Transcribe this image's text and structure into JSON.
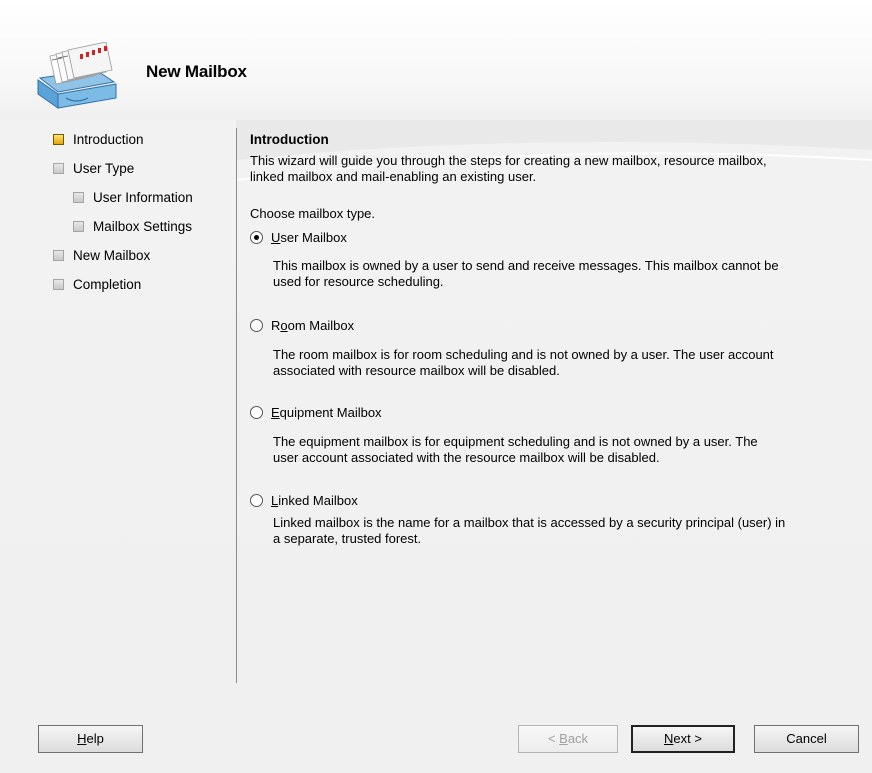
{
  "header": {
    "title": "New Mailbox",
    "icon": "mailbox-stack-icon"
  },
  "steps": [
    {
      "label": "Introduction",
      "state": "active"
    },
    {
      "label": "User Type",
      "state": "pending"
    },
    {
      "label": "User Information",
      "state": "pending"
    },
    {
      "label": "Mailbox Settings",
      "state": "pending"
    },
    {
      "label": "New Mailbox",
      "state": "pending"
    },
    {
      "label": "Completion",
      "state": "pending"
    }
  ],
  "content": {
    "title": "Introduction",
    "intro_line1": "This wizard will guide you through the steps for creating a new mailbox, resource mailbox,",
    "intro_line2": "linked mailbox and mail-enabling an existing user.",
    "choose_label": "Choose mailbox type.",
    "options": [
      {
        "label": "User Mailbox",
        "access_key": "U",
        "rest": "ser Mailbox",
        "selected": true,
        "desc1": "This mailbox is owned by a user to send and receive messages. This mailbox cannot be",
        "desc2": "used for resource scheduling."
      },
      {
        "label": "Room Mailbox",
        "prefix": "R",
        "access_key": "o",
        "rest": "om Mailbox",
        "selected": false,
        "desc1": "The room mailbox is for room scheduling and is not owned by a user. The user account",
        "desc2": "associated with resource mailbox will be disabled."
      },
      {
        "label": "Equipment Mailbox",
        "access_key": "E",
        "rest": "quipment Mailbox",
        "selected": false,
        "desc1": "The equipment mailbox is for equipment scheduling and is not owned by a user. The",
        "desc2": "user account associated with the resource mailbox will be disabled."
      },
      {
        "label": "Linked Mailbox",
        "access_key": "L",
        "rest": "inked Mailbox",
        "selected": false,
        "desc1": "Linked mailbox is the name for a mailbox that is accessed by a security principal (user) in",
        "desc2": "a separate, trusted forest."
      }
    ]
  },
  "buttons": {
    "help": {
      "label": "Help",
      "access_key": "H",
      "rest": "elp"
    },
    "back": {
      "label": "< Back",
      "prefix": "< ",
      "access_key": "B",
      "rest": "ack",
      "enabled": false
    },
    "next": {
      "label": "Next >",
      "access_key": "N",
      "rest": "ext >"
    },
    "cancel": {
      "label": "Cancel"
    }
  },
  "colors": {
    "active_step": "#f2c200",
    "background": "#f0f0f0"
  }
}
